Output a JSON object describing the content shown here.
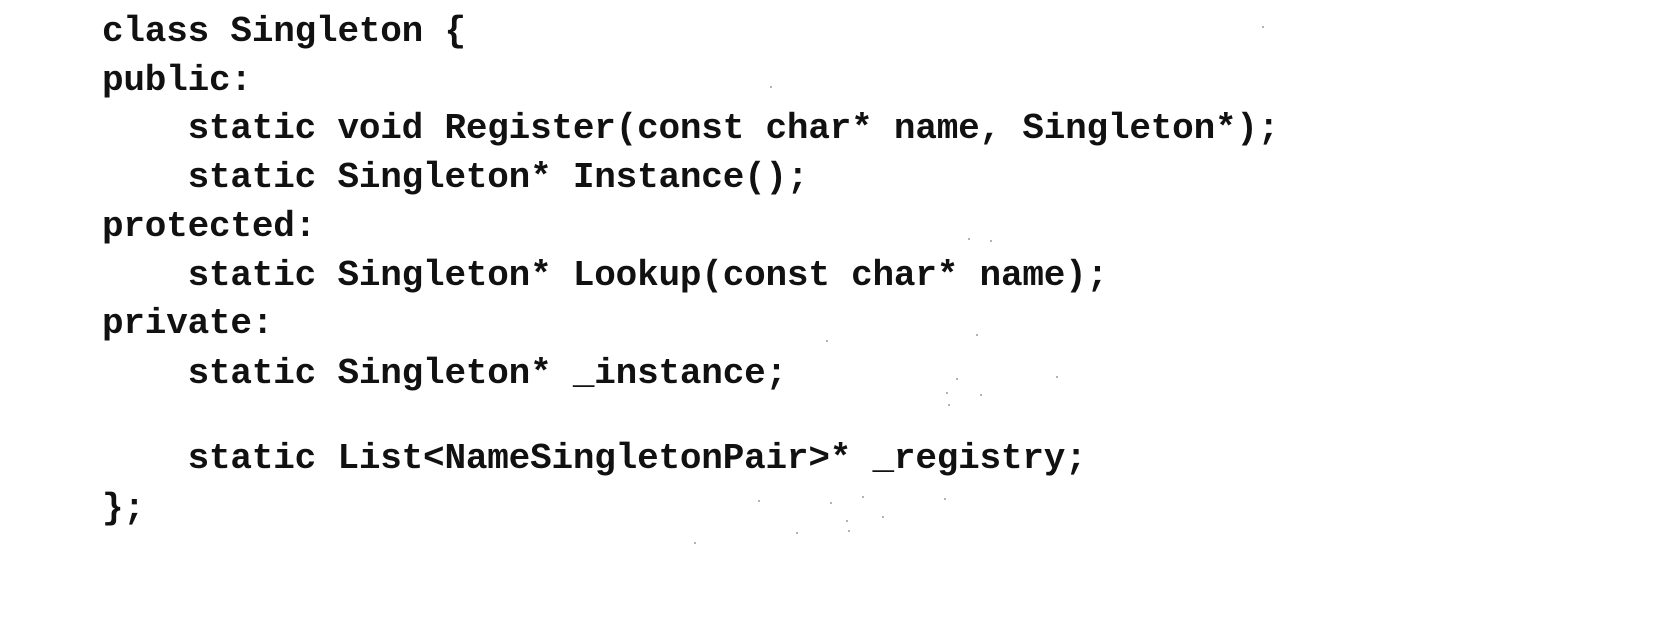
{
  "code": {
    "lines": [
      "class Singleton {",
      "public:",
      "    static void Register(const char* name, Singleton*);",
      "    static Singleton* Instance();",
      "protected:",
      "    static Singleton* Lookup(const char* name);",
      "private:",
      "    static Singleton* _instance;",
      "    static List<NameSingletonPair>* _registry;",
      "};"
    ]
  }
}
